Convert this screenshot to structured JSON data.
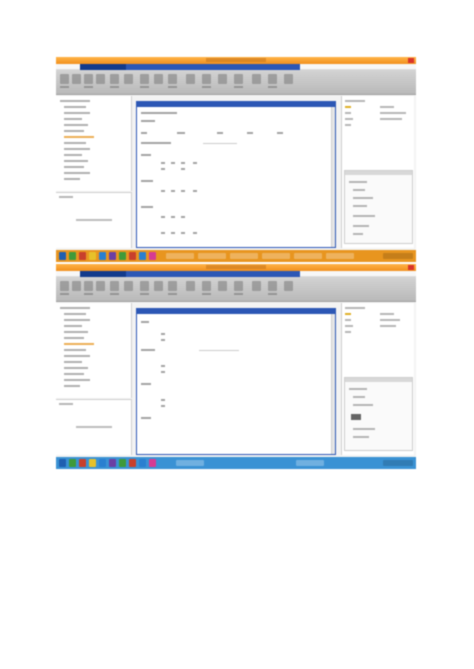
{
  "screens": [
    {
      "id": "shot1",
      "taskbar_color": "#e8951f",
      "window_controls": [
        "close"
      ],
      "icons": [
        "app-icon",
        "toolbar-icon",
        "close-icon",
        "start-icon"
      ]
    },
    {
      "id": "shot2",
      "taskbar_color": "#3a92d4",
      "window_controls": [
        "close"
      ],
      "icons": [
        "app-icon",
        "toolbar-icon",
        "close-icon",
        "start-icon"
      ]
    }
  ],
  "colors": {
    "title_orange": "#f2901d",
    "tab_blue": "#2c57b5",
    "close_red": "#d9342b",
    "highlight_yellow": "#d9a200"
  }
}
